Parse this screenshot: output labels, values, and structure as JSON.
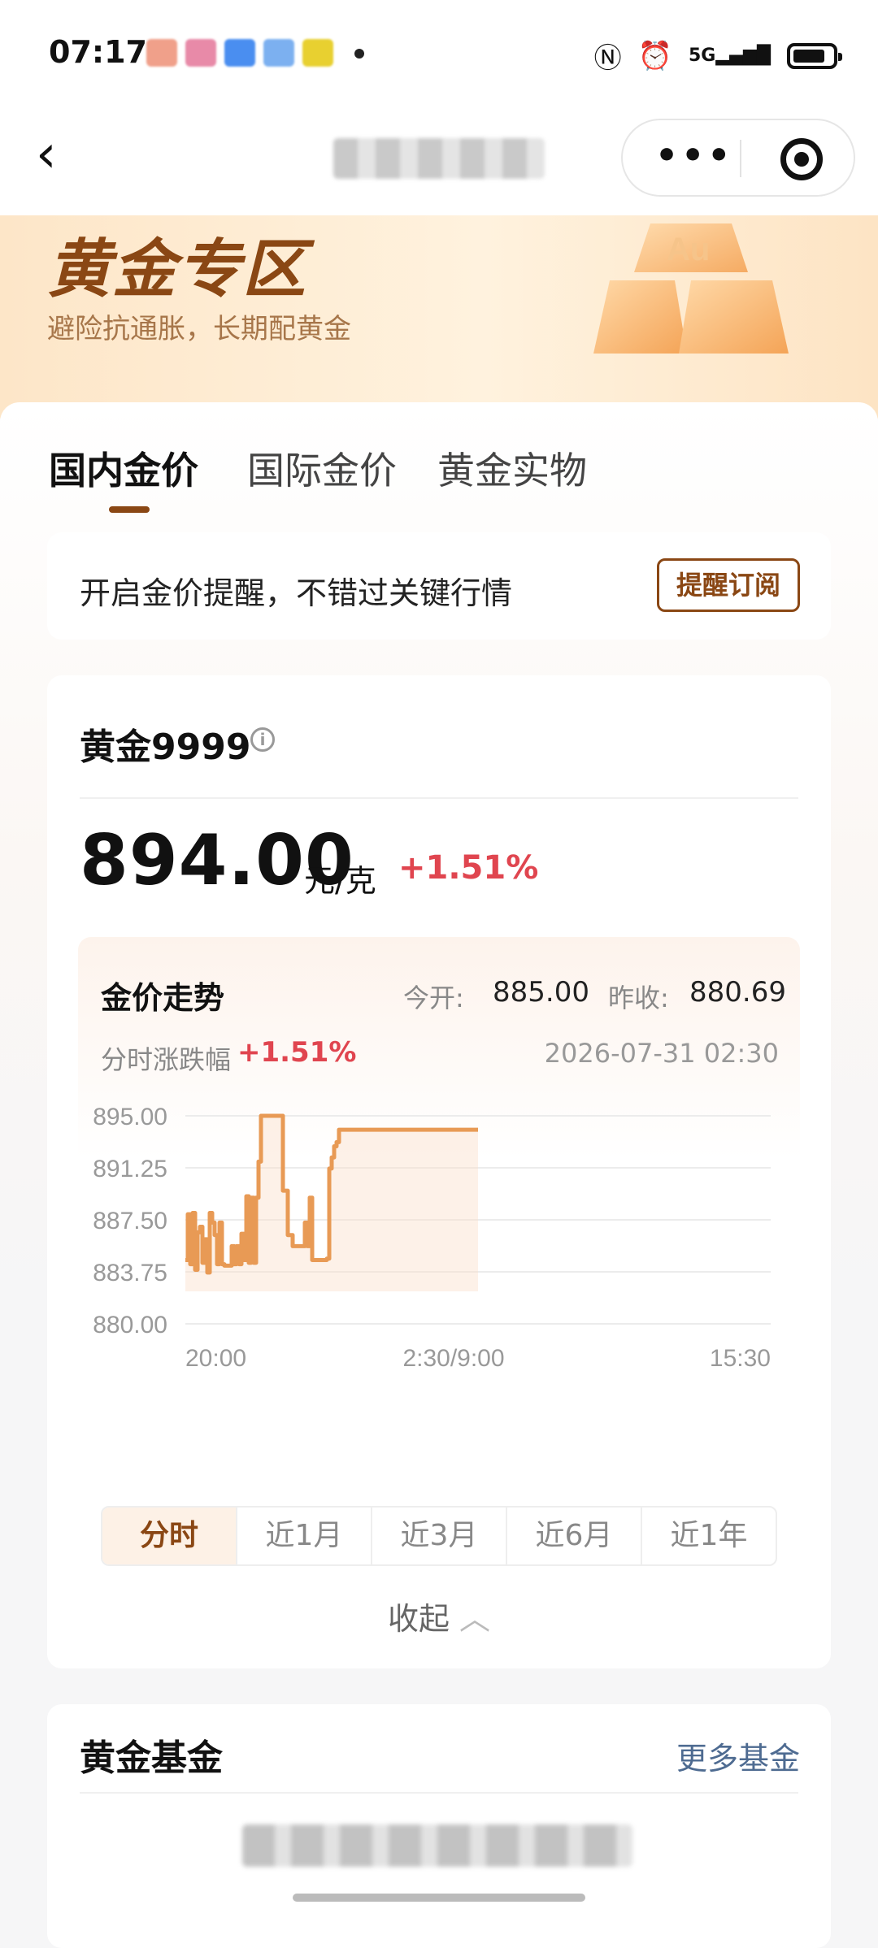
{
  "status_bar": {
    "time": "07:17",
    "network": "5G"
  },
  "banner": {
    "title": "黄金专区",
    "subtitle": "避险抗通胀，长期配黄金"
  },
  "tabs": [
    "国内金价",
    "国际金价",
    "黄金实物"
  ],
  "reminder": {
    "text": "开启金价提醒，不错过关键行情",
    "button": "提醒订阅"
  },
  "quote": {
    "name": "黄金9999",
    "price": "894.00",
    "unit": "元/克",
    "change": "+1.51%"
  },
  "trend": {
    "title": "金价走势",
    "open_label": "今开:",
    "open_value": "885.00",
    "prev_label": "昨收:",
    "prev_value": "880.69",
    "intraday_label": "分时涨跌幅",
    "intraday_value": "+1.51%",
    "timestamp": "2026-07-31 02:30",
    "ranges": [
      "分时",
      "近1月",
      "近3月",
      "近6月",
      "近1年"
    ]
  },
  "chart_data": {
    "type": "line",
    "x_ticks": [
      "20:00",
      "2:30/9:00",
      "15:30"
    ],
    "y_ticks": [
      "895.00",
      "891.25",
      "887.50",
      "883.75",
      "880.00"
    ],
    "ylim": [
      880,
      895
    ],
    "series": [
      {
        "x": [
          0,
          0.5,
          1,
          1.5,
          2,
          2.5,
          3,
          3.5,
          4,
          4.5,
          5,
          5.5,
          6,
          6.5,
          7,
          7.5,
          8,
          9,
          9.5,
          10,
          10.5,
          11,
          11.5,
          12,
          12.5,
          13,
          13.5,
          14,
          14.5,
          15,
          15.5,
          16,
          16.5,
          17,
          17.5,
          18,
          18.5,
          19,
          20,
          21,
          22,
          22.5,
          23,
          23.5,
          24,
          24.5,
          25,
          25.5,
          26,
          27,
          28,
          28.5,
          29,
          29.5,
          30,
          30.5,
          31,
          31.5,
          32,
          33,
          34,
          35,
          36,
          37,
          38,
          39,
          40,
          41,
          42,
          43,
          44,
          45,
          46,
          48,
          50,
          52,
          54,
          56,
          58,
          60
        ],
        "values": [
          884.6,
          887.9,
          884.3,
          888.0,
          883.9,
          886.6,
          887.0,
          884.4,
          886.1,
          883.7,
          888.0,
          887.3,
          886.4,
          884.3,
          887.3,
          884.3,
          884.2,
          884.2,
          885.6,
          884.3,
          885.6,
          884.3,
          886.5,
          884.6,
          889.2,
          884.4,
          889.1,
          884.4,
          889.1,
          891.7,
          895.0,
          895.0,
          895.0,
          895.0,
          895.0,
          895.0,
          895.0,
          895.0,
          889.6,
          886.4,
          885.6,
          885.6,
          885.6,
          885.6,
          885.6,
          887.3,
          885.6,
          889.1,
          884.6,
          884.6,
          884.6,
          884.6,
          884.7,
          891.2,
          892.0,
          892.8,
          893.1,
          894.0,
          894.0,
          894.0,
          894.0,
          894.0,
          894.0,
          894.0,
          894.0,
          894.0,
          894.0,
          894.0,
          894.0,
          894.0,
          894.0,
          894.0,
          894.0,
          894.0,
          894.0,
          894.0,
          894.0,
          894.0,
          894.0,
          894.0
        ]
      }
    ],
    "x_total": 120,
    "line_color": "#e89a55",
    "fill_color": "#fbe0cc"
  },
  "collapse_label": "收起",
  "funds": {
    "title": "黄金基金",
    "more": "更多基金"
  }
}
